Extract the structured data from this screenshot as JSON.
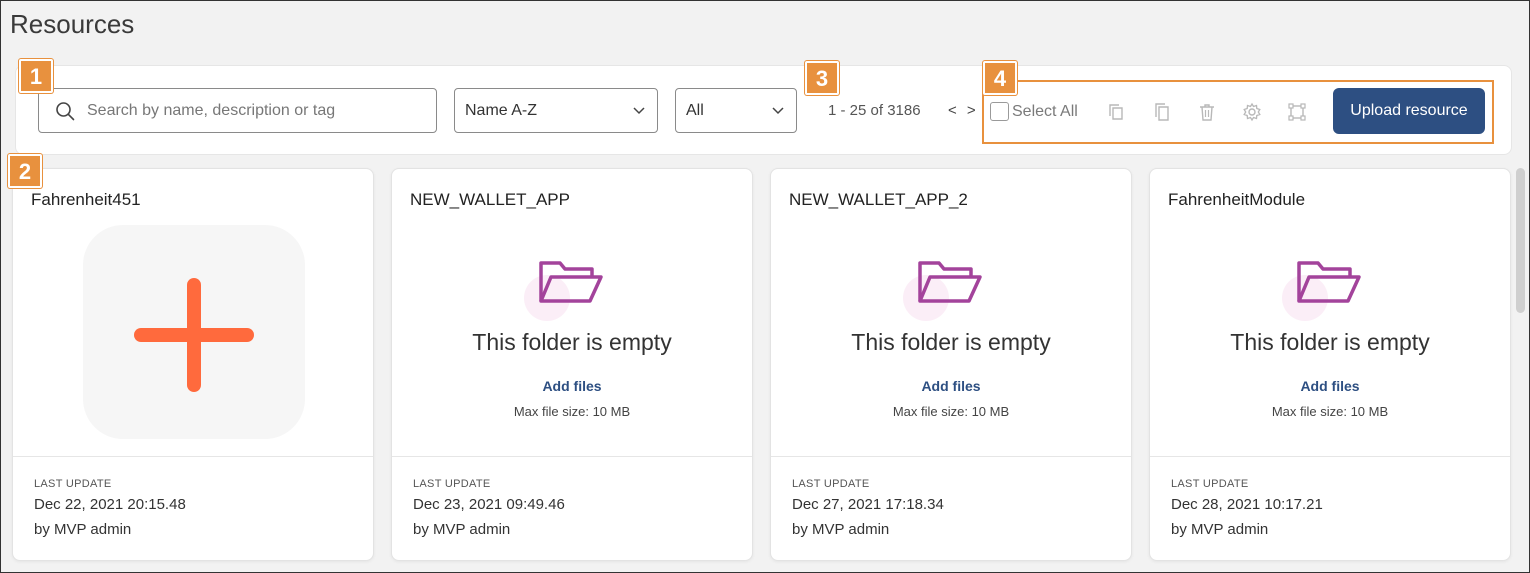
{
  "page": {
    "title": "Resources"
  },
  "toolbar": {
    "search_placeholder": "Search by name, description or tag",
    "sort_value": "Name A-Z",
    "filter_value": "All",
    "pagination": "1 - 25 of 3186",
    "pager_arrows": "< >",
    "select_all_label": "Select All",
    "upload_label": "Upload resource"
  },
  "badges": [
    "1",
    "2",
    "3",
    "4"
  ],
  "cards": [
    {
      "title": "Fahrenheit451",
      "has_thumbnail": true,
      "last_update_label": "LAST UPDATE",
      "date": "Dec 22, 2021 20:15.48",
      "by": "by MVP admin"
    },
    {
      "title": "NEW_WALLET_APP",
      "empty_text": "This folder is empty",
      "add_files": "Add files",
      "max_size": "Max file size: 10 MB",
      "last_update_label": "LAST UPDATE",
      "date": "Dec 23, 2021 09:49.46",
      "by": "by MVP admin"
    },
    {
      "title": "NEW_WALLET_APP_2",
      "empty_text": "This folder is empty",
      "add_files": "Add files",
      "max_size": "Max file size: 10 MB",
      "last_update_label": "LAST UPDATE",
      "date": "Dec 27, 2021 17:18.34",
      "by": "by MVP admin"
    },
    {
      "title": "FahrenheitModule",
      "empty_text": "This folder is empty",
      "add_files": "Add files",
      "max_size": "Max file size: 10 MB",
      "last_update_label": "LAST UPDATE",
      "date": "Dec 28, 2021 10:17.21",
      "by": "by MVP admin"
    }
  ],
  "icons": {
    "search": "search-icon",
    "sort_chevron": "chevron-down-icon",
    "folder": "folder-open-icon",
    "plus": "plus-icon",
    "actions": [
      "copy-icon",
      "duplicate-icon",
      "trash-icon",
      "gear-icon",
      "expand-icon"
    ]
  },
  "colors": {
    "accent_orange": "#e8913e",
    "primary_button": "#2d4f82",
    "folder_purple": "#a3439b",
    "plus_orange": "#ff6a3d",
    "link_blue": "#2d4f82"
  }
}
